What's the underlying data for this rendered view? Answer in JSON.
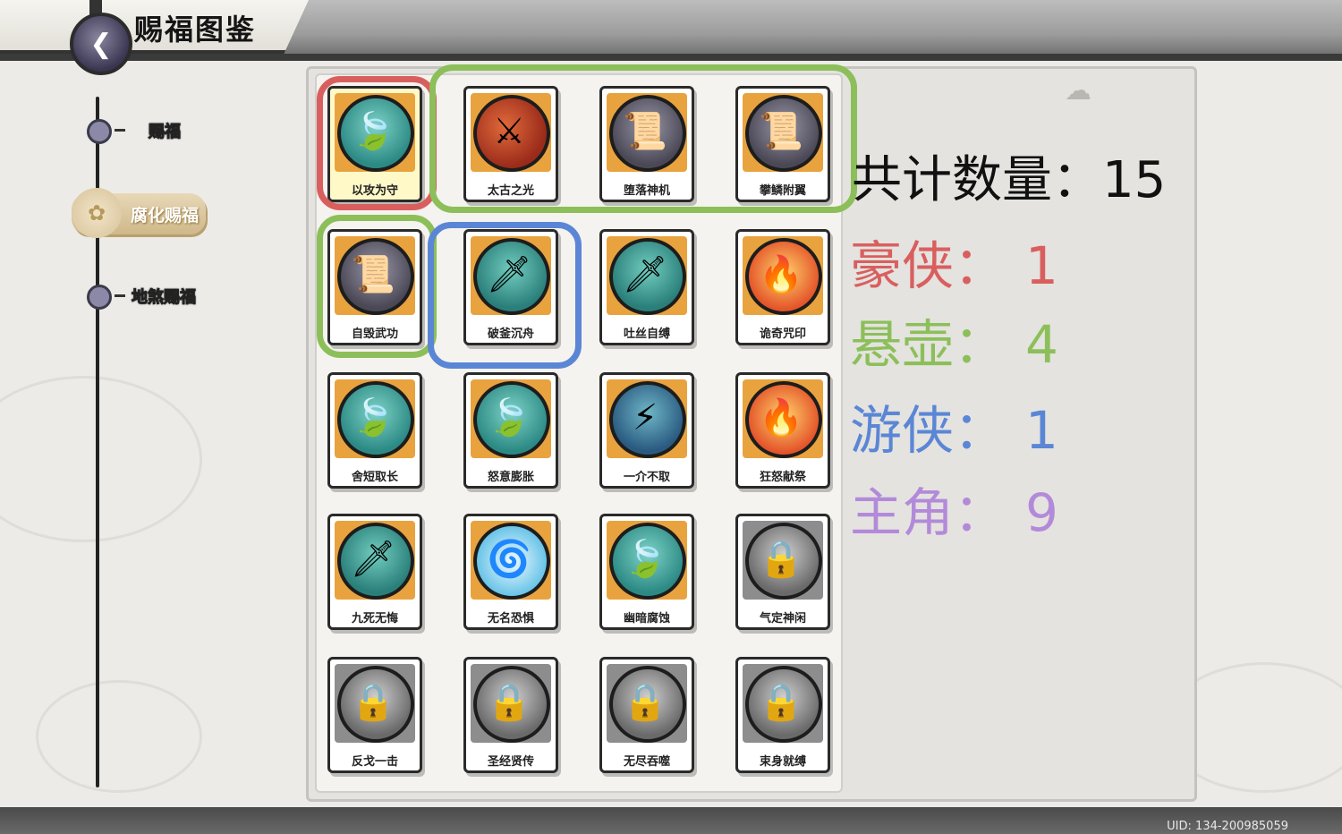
{
  "header": {
    "title": "赐福图鉴",
    "back_glyph": "❮"
  },
  "nav": {
    "items": [
      {
        "label": "赐福",
        "active": false
      },
      {
        "label": "腐化赐福",
        "active": true
      },
      {
        "label": "地煞赐福",
        "active": false
      }
    ]
  },
  "cards": [
    {
      "name": "以攻为守",
      "icon": "leaf-water-icon",
      "locked": false
    },
    {
      "name": "太古之光",
      "icon": "blade-flame-icon",
      "locked": false
    },
    {
      "name": "堕落神机",
      "icon": "scroll-bag-icon",
      "locked": false
    },
    {
      "name": "攀鳞附翼",
      "icon": "scroll-bag-icon",
      "locked": false
    },
    {
      "name": "自毁武功",
      "icon": "scroll-bag-icon",
      "locked": false
    },
    {
      "name": "破釜沉舟",
      "icon": "broken-blade-icon",
      "locked": false
    },
    {
      "name": "吐丝自缚",
      "icon": "broken-blade-icon",
      "locked": false
    },
    {
      "name": "诡奇咒印",
      "icon": "flame-swirl-icon",
      "locked": false
    },
    {
      "name": "舍短取长",
      "icon": "leaf-water-icon",
      "locked": false
    },
    {
      "name": "怒意膨胀",
      "icon": "leaf-water-icon",
      "locked": false
    },
    {
      "name": "一介不取",
      "icon": "lightning-tornado-icon",
      "locked": false
    },
    {
      "name": "狂怒献祭",
      "icon": "flame-swirl-icon",
      "locked": false
    },
    {
      "name": "九死无悔",
      "icon": "broken-blade-icon",
      "locked": false
    },
    {
      "name": "无名恐惧",
      "icon": "vortex-icon",
      "locked": false
    },
    {
      "name": "幽暗腐蚀",
      "icon": "leaf-water-icon",
      "locked": false
    },
    {
      "name": "气定神闲",
      "icon": "lock-icon",
      "locked": true
    },
    {
      "name": "反戈一击",
      "icon": "lock-icon",
      "locked": true
    },
    {
      "name": "圣经贤传",
      "icon": "lock-icon",
      "locked": true
    },
    {
      "name": "无尽吞噬",
      "icon": "lock-icon",
      "locked": true
    },
    {
      "name": "束身就缚",
      "icon": "lock-icon",
      "locked": true
    }
  ],
  "stats": {
    "total": {
      "label": "共计数量：",
      "value": "15",
      "color": "#111111"
    },
    "haoxia": {
      "label": "豪侠：",
      "value": "1",
      "color": "#d95f5f"
    },
    "xuanhu": {
      "label": "悬壶：",
      "value": "4",
      "color": "#8cbf5a"
    },
    "youxia": {
      "label": "游侠：",
      "value": "1",
      "color": "#5b86d6"
    },
    "zhujue": {
      "label": "主角：",
      "value": "9",
      "color": "#b38ad9"
    }
  },
  "highlights": {
    "haoxia_color": "#d95f5f",
    "xuanhu_color": "#8cbf5a",
    "youxia_color": "#5b86d6"
  },
  "footer": {
    "uid": "UID: 134-200985059"
  }
}
